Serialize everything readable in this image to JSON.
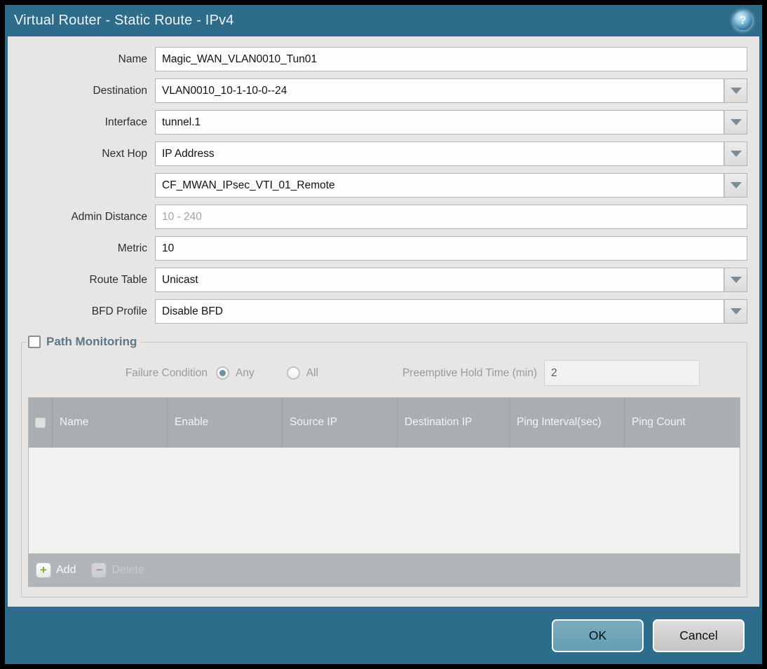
{
  "title_bar": {
    "title": "Virtual Router - Static Route - IPv4",
    "help_glyph": "?"
  },
  "form": {
    "name": {
      "label": "Name",
      "value": "Magic_WAN_VLAN0010_Tun01"
    },
    "destination": {
      "label": "Destination",
      "value": "VLAN0010_10-1-10-0--24"
    },
    "interface": {
      "label": "Interface",
      "value": "tunnel.1"
    },
    "next_hop": {
      "label": "Next Hop",
      "value": "IP Address"
    },
    "next_hop_address": {
      "value": "CF_MWAN_IPsec_VTI_01_Remote"
    },
    "admin_distance": {
      "label": "Admin Distance",
      "placeholder": "10 - 240"
    },
    "metric": {
      "label": "Metric",
      "value": "10"
    },
    "route_table": {
      "label": "Route Table",
      "value": "Unicast"
    },
    "bfd_profile": {
      "label": "BFD Profile",
      "value": "Disable BFD"
    }
  },
  "path_monitoring": {
    "legend": "Path Monitoring",
    "checkbox_checked": false,
    "failure_condition": {
      "label": "Failure Condition",
      "options": [
        "Any",
        "All"
      ],
      "selected": "Any"
    },
    "preemptive_hold_time": {
      "label": "Preemptive Hold Time (min)",
      "value": "2"
    },
    "table": {
      "headers": [
        "Name",
        "Enable",
        "Source IP",
        "Destination IP",
        "Ping Interval(sec)",
        "Ping Count"
      ],
      "rows": []
    },
    "toolbar": {
      "add_label": "Add",
      "delete_label": "Delete"
    }
  },
  "footer": {
    "ok_label": "OK",
    "cancel_label": "Cancel"
  },
  "colors": {
    "frame_teal": "#2d6c8a",
    "body_gray": "#e7e6e5",
    "table_header_gray": "#a9aeb1",
    "ok_button_blue": "#6fa3b8",
    "add_green": "#8aa736",
    "delete_red": "#b2595e"
  }
}
